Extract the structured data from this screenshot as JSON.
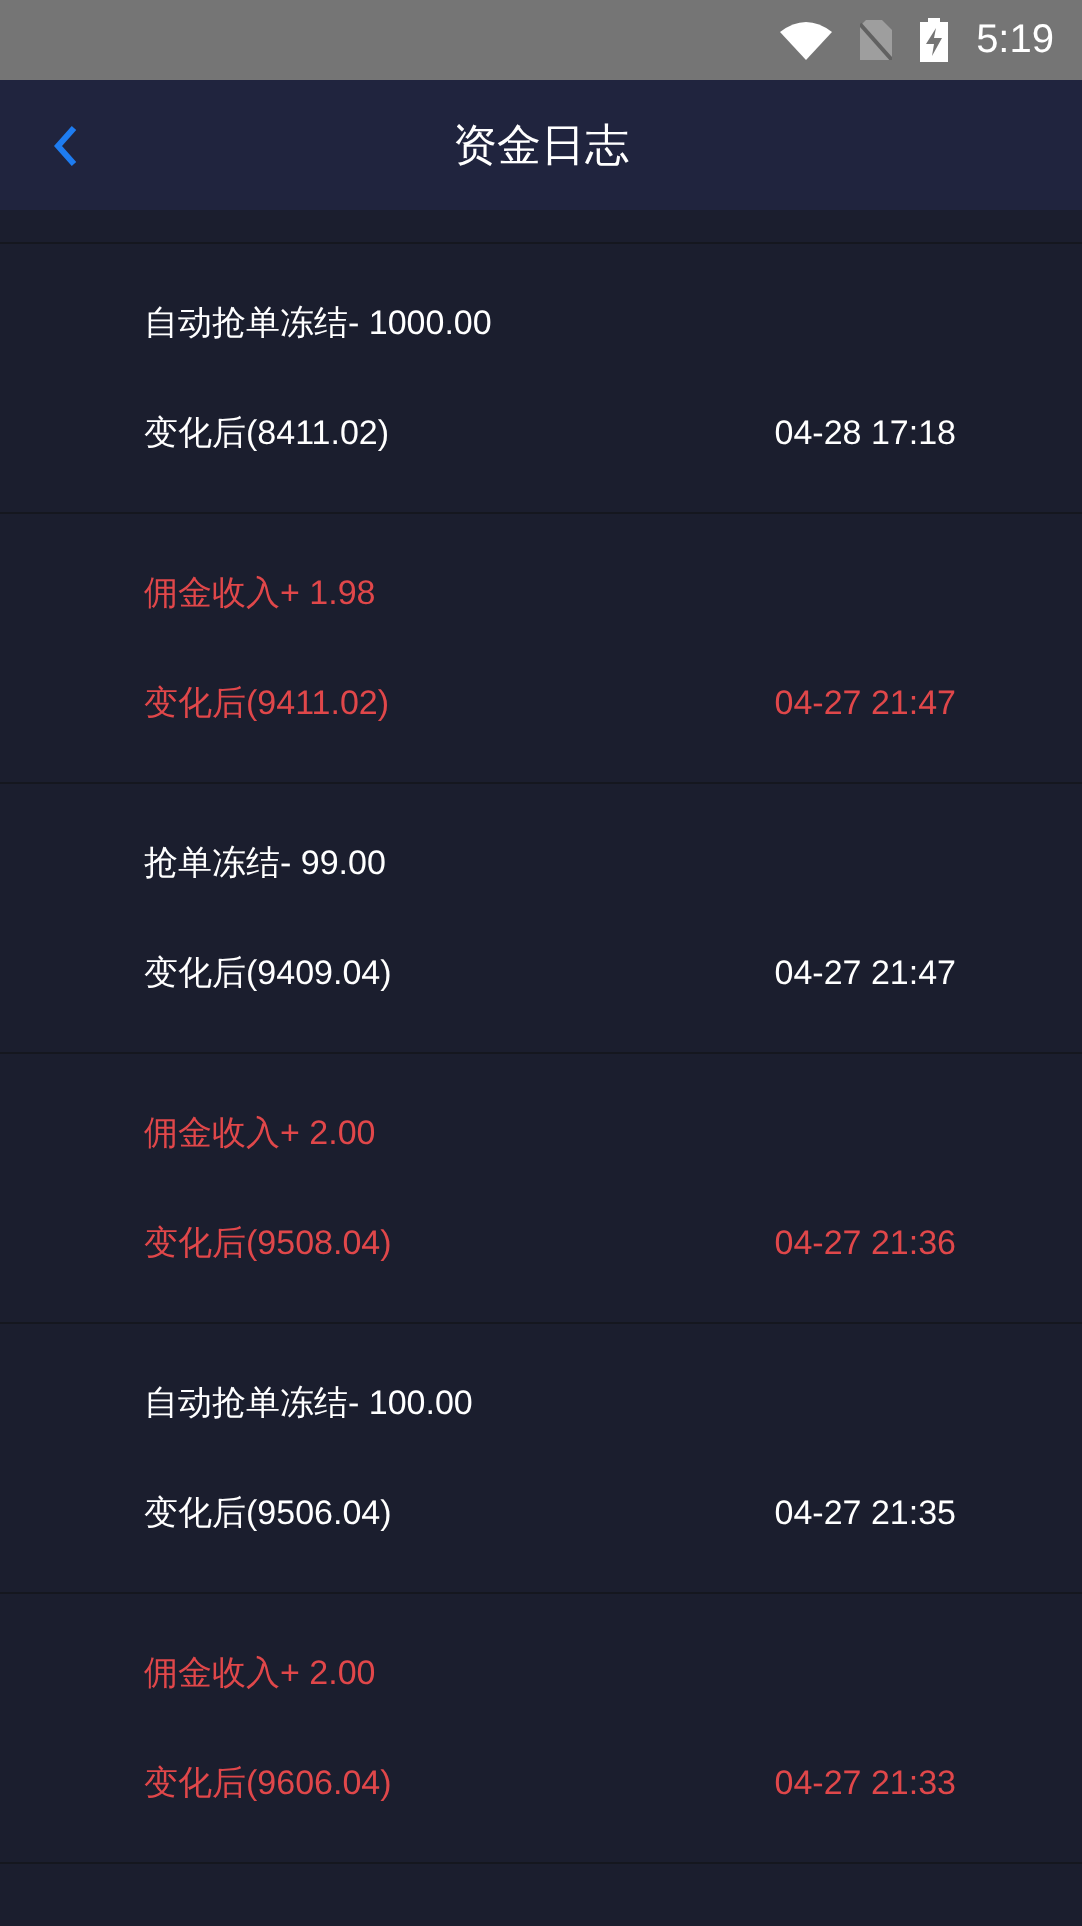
{
  "status_bar": {
    "time": "5:19"
  },
  "header": {
    "title": "资金日志"
  },
  "entries": [
    {
      "kind": "debit",
      "description": "自动抢单冻结- 1000.00",
      "balance": "变化后(8411.02)",
      "time": "04-28 17:18"
    },
    {
      "kind": "credit",
      "description": "佣金收入+ 1.98",
      "balance": "变化后(9411.02)",
      "time": "04-27 21:47"
    },
    {
      "kind": "debit",
      "description": "抢单冻结- 99.00",
      "balance": "变化后(9409.04)",
      "time": "04-27 21:47"
    },
    {
      "kind": "credit",
      "description": "佣金收入+ 2.00",
      "balance": "变化后(9508.04)",
      "time": "04-27 21:36"
    },
    {
      "kind": "debit",
      "description": "自动抢单冻结- 100.00",
      "balance": "变化后(9506.04)",
      "time": "04-27 21:35"
    },
    {
      "kind": "credit",
      "description": "佣金收入+ 2.00",
      "balance": "变化后(9606.04)",
      "time": "04-27 21:33"
    }
  ]
}
